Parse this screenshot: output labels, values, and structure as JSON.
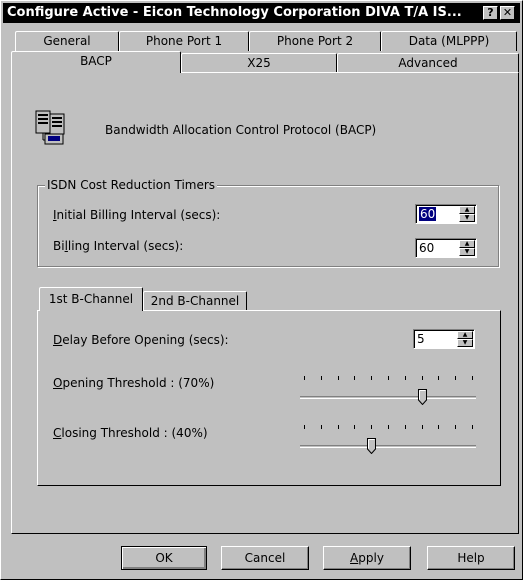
{
  "window": {
    "title": "Configure Active - Eicon Technology Corporation DIVA T/A IS...",
    "help_btn": "?",
    "close_btn": "✕"
  },
  "tabs_row1": [
    "General",
    "Phone Port 1",
    "Phone Port 2",
    "Data (MLPPP)"
  ],
  "tabs_row2": [
    "BACP",
    "X25",
    "Advanced"
  ],
  "header": {
    "text": "Bandwidth Allocation Control Protocol (BACP)",
    "icon": "computer-network-icon"
  },
  "isdn_group": {
    "label": "ISDN Cost Reduction Timers",
    "initial_label_ul": "I",
    "initial_label_rest": "nitial Billing Interval (secs):",
    "initial_value": "60",
    "billing_label_pre": "Bi",
    "billing_label_ul": "l",
    "billing_label_rest": "ling Interval (secs):",
    "billing_value": "60"
  },
  "channel_tabs": [
    "1st B-Channel",
    "2nd B-Channel"
  ],
  "channel": {
    "delay_ul": "D",
    "delay_rest": "elay Before Opening (secs):",
    "delay_value": "5",
    "opening_ul": "O",
    "opening_rest": "pening Threshold : (70%)",
    "opening_level": 0.7,
    "closing_ul": "C",
    "closing_rest": "losing Threshold : (40%)",
    "closing_level": 0.4
  },
  "buttons": {
    "ok": "OK",
    "cancel": "Cancel",
    "apply_ul": "A",
    "apply_rest": "pply",
    "help": "Help"
  }
}
